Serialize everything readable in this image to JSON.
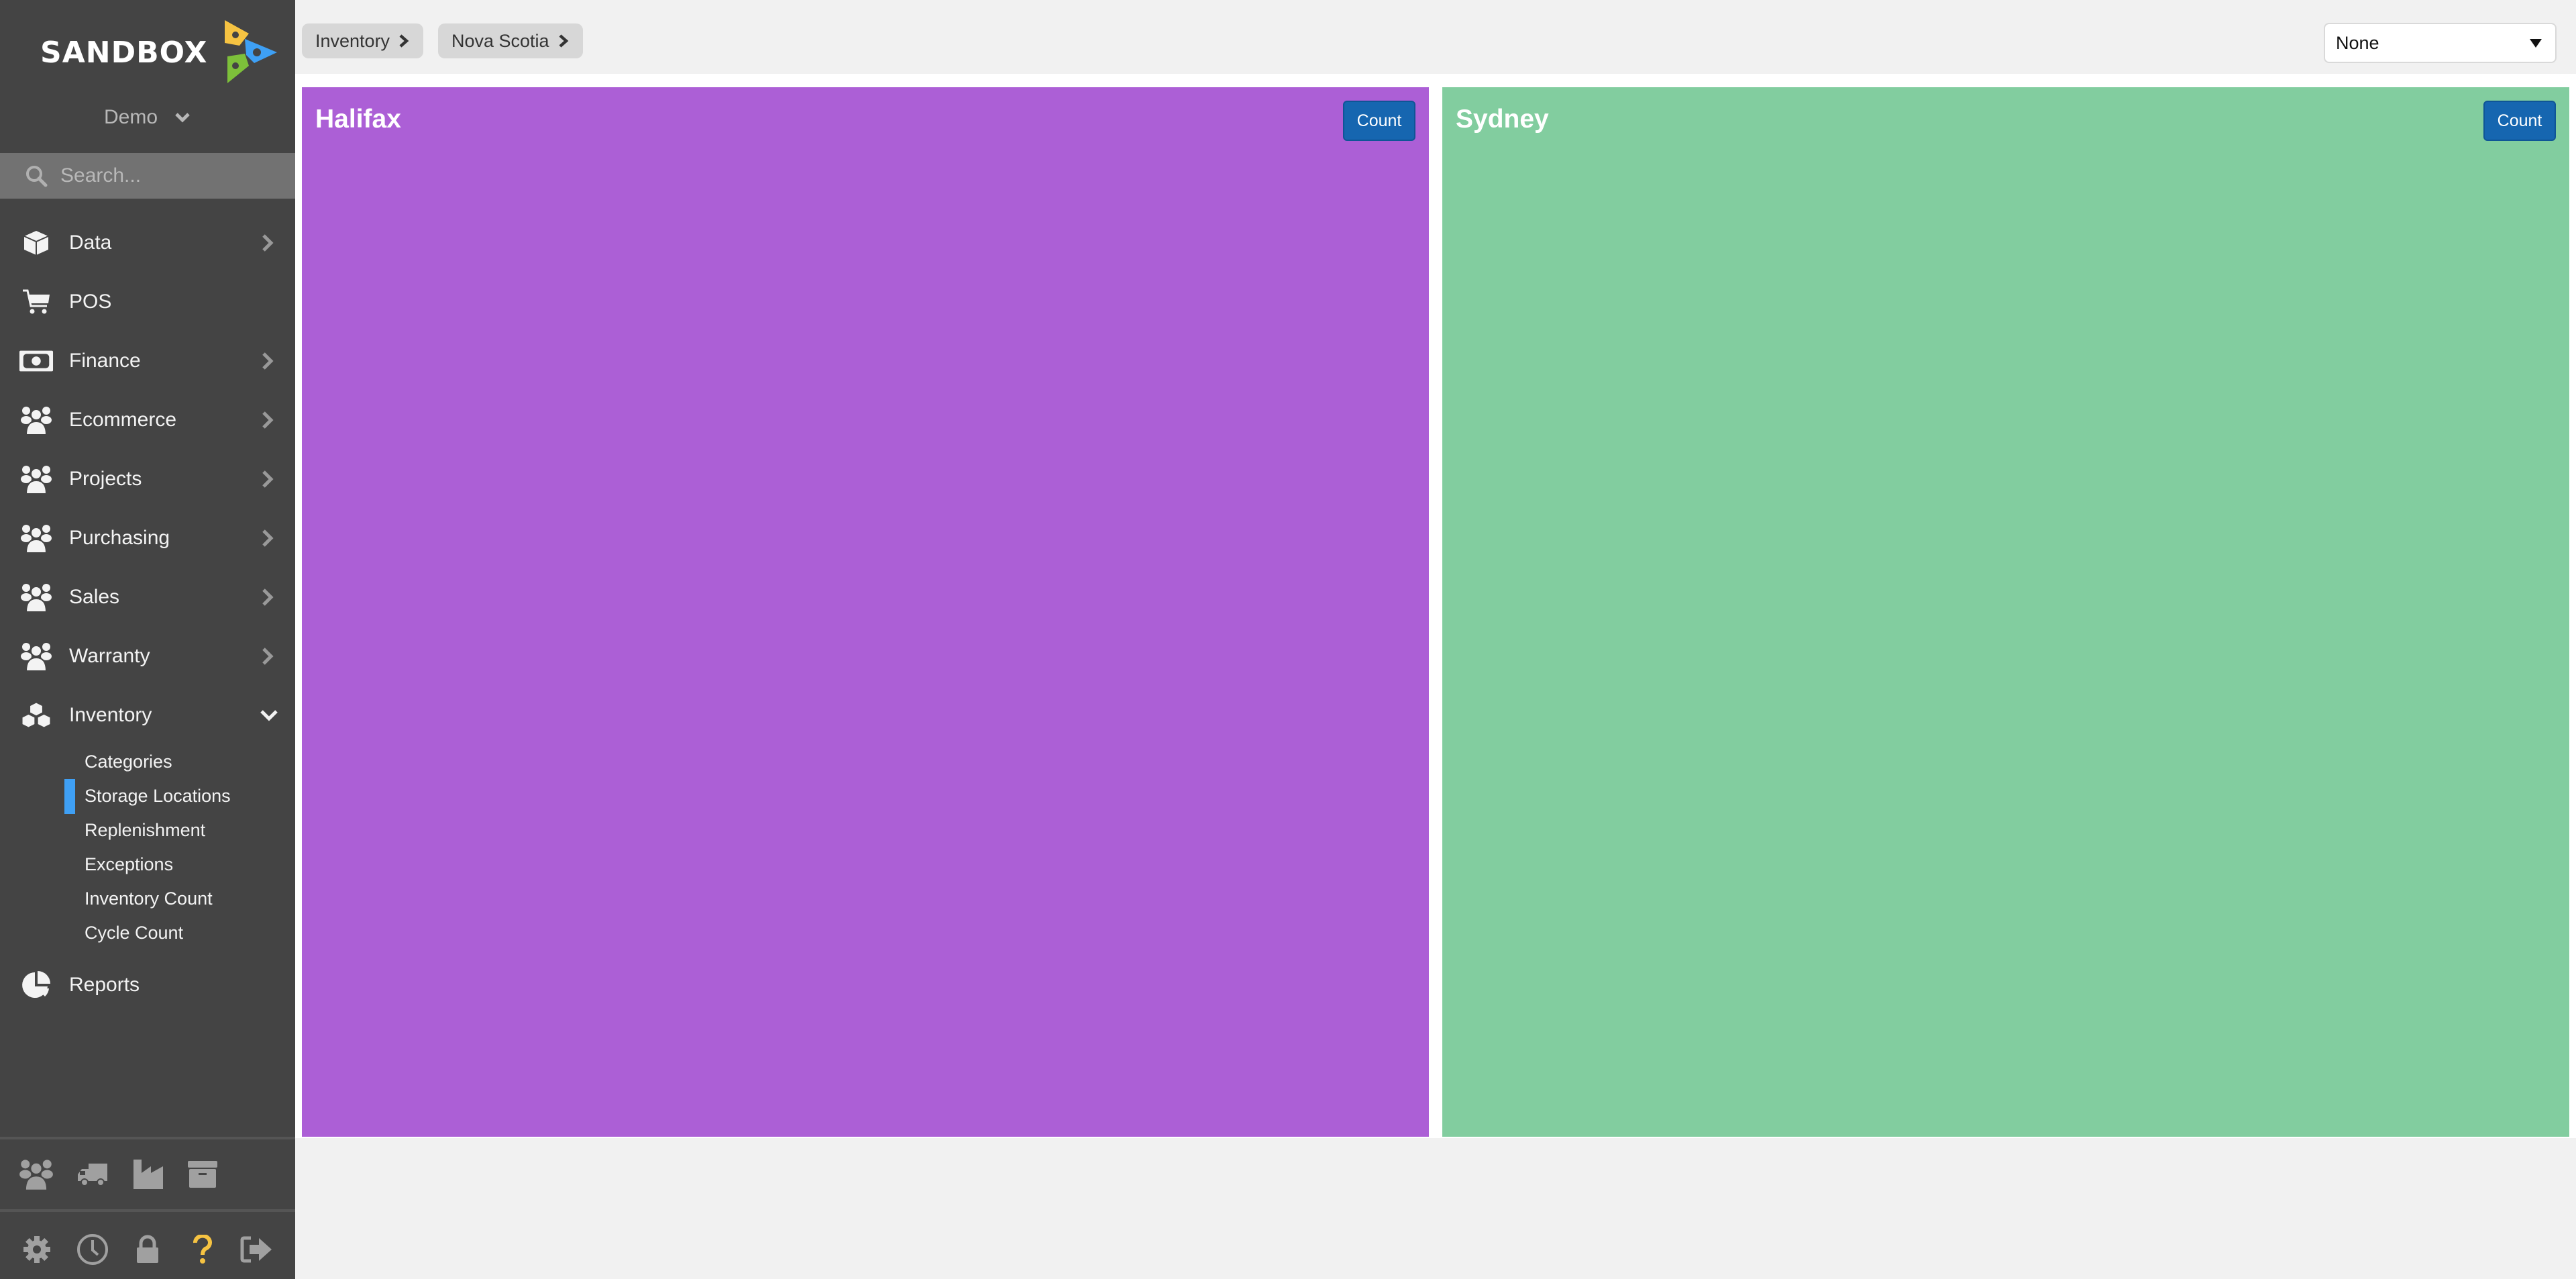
{
  "brand": {
    "name": "SANDBOX",
    "logo_colors": [
      "#f6c342",
      "#3ea0f5",
      "#7dc03a"
    ]
  },
  "org_switcher": {
    "label": "Demo"
  },
  "search": {
    "placeholder": "Search..."
  },
  "sidebar": {
    "items": [
      {
        "label": "Data",
        "icon": "cube-icon",
        "has_children": true,
        "expanded": false
      },
      {
        "label": "POS",
        "icon": "cart-icon",
        "has_children": false
      },
      {
        "label": "Finance",
        "icon": "money-bill-icon",
        "has_children": true,
        "expanded": false
      },
      {
        "label": "Ecommerce",
        "icon": "users-icon",
        "has_children": true,
        "expanded": false
      },
      {
        "label": "Projects",
        "icon": "users-icon",
        "has_children": true,
        "expanded": false
      },
      {
        "label": "Purchasing",
        "icon": "users-icon",
        "has_children": true,
        "expanded": false
      },
      {
        "label": "Sales",
        "icon": "users-icon",
        "has_children": true,
        "expanded": false
      },
      {
        "label": "Warranty",
        "icon": "users-icon",
        "has_children": true,
        "expanded": false
      },
      {
        "label": "Inventory",
        "icon": "cubes-icon",
        "has_children": true,
        "expanded": true,
        "children": [
          {
            "label": "Categories",
            "active": false
          },
          {
            "label": "Storage Locations",
            "active": true
          },
          {
            "label": "Replenishment",
            "active": false
          },
          {
            "label": "Exceptions",
            "active": false
          },
          {
            "label": "Inventory Count",
            "active": false
          },
          {
            "label": "Cycle Count",
            "active": false
          }
        ]
      },
      {
        "label": "Reports",
        "icon": "pie-chart-icon",
        "has_children": false
      }
    ],
    "active_accent": "#3fa0f5",
    "quick_icons": [
      "users-icon",
      "truck-icon",
      "factory-icon",
      "archive-icon"
    ],
    "footer_icons": [
      "gear-icon",
      "clock-icon",
      "lock-icon",
      "help-icon",
      "sign-out-icon"
    ],
    "help_color": "#f6c342"
  },
  "breadcrumb": [
    {
      "label": "Inventory"
    },
    {
      "label": "Nova Scotia"
    }
  ],
  "filter_select": {
    "value": "None"
  },
  "locations": [
    {
      "name": "Halifax",
      "color": "#ac5fd6",
      "button_label": "Count"
    },
    {
      "name": "Sydney",
      "color": "#82cd9f",
      "button_label": "Count"
    }
  ],
  "button_color": "#1666b0"
}
